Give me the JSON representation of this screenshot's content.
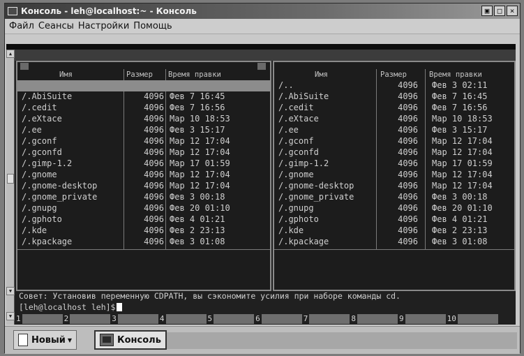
{
  "window": {
    "title": "Консоль - leh@localhost:~ - Консоль",
    "buttons": [
      "▣",
      "□",
      "×"
    ]
  },
  "menu": [
    "Файл",
    "Сеансы",
    "Настройки",
    "Помощь"
  ],
  "left_panel": {
    "headers": {
      "name": "Имя",
      "size": "Размер",
      "mtime": "Время правки"
    },
    "rows": [
      {
        "name": "",
        "size": "",
        "date": "",
        "selected": true
      },
      {
        "name": "/.AbiSuite",
        "size": "4096",
        "date": "Фев  7 16:45"
      },
      {
        "name": "/.cedit",
        "size": "4096",
        "date": "Фев  7 16:56"
      },
      {
        "name": "/.eXtace",
        "size": "4096",
        "date": "Мар 10 18:53"
      },
      {
        "name": "/.ee",
        "size": "4096",
        "date": "Фев  3 15:17"
      },
      {
        "name": "/.gconf",
        "size": "4096",
        "date": "Мар 12 17:04"
      },
      {
        "name": "/.gconfd",
        "size": "4096",
        "date": "Мар 12 17:04"
      },
      {
        "name": "/.gimp-1.2",
        "size": "4096",
        "date": "Мар 17 01:59"
      },
      {
        "name": "/.gnome",
        "size": "4096",
        "date": "Мар 12 17:04"
      },
      {
        "name": "/.gnome-desktop",
        "size": "4096",
        "date": "Мар 12 17:04"
      },
      {
        "name": "/.gnome_private",
        "size": "4096",
        "date": "Фев  3 00:18"
      },
      {
        "name": "/.gnupg",
        "size": "4096",
        "date": "Фев 20 01:10"
      },
      {
        "name": "/.gphoto",
        "size": "4096",
        "date": "Фев  4 01:21"
      },
      {
        "name": "/.kde",
        "size": "4096",
        "date": "Фев  2 23:13"
      },
      {
        "name": "/.kpackage",
        "size": "4096",
        "date": "Фев  3 01:08"
      }
    ]
  },
  "right_panel": {
    "headers": {
      "name": "Имя",
      "size": "Размер",
      "mtime": "Время правки"
    },
    "rows": [
      {
        "name": "/..",
        "size": "4096",
        "date": "Фев  3 02:11"
      },
      {
        "name": "/.AbiSuite",
        "size": "4096",
        "date": "Фев  7 16:45"
      },
      {
        "name": "/.cedit",
        "size": "4096",
        "date": "Фев  7 16:56"
      },
      {
        "name": "/.eXtace",
        "size": "4096",
        "date": "Мар 10 18:53"
      },
      {
        "name": "/.ee",
        "size": "4096",
        "date": "Фев  3 15:17"
      },
      {
        "name": "/.gconf",
        "size": "4096",
        "date": "Мар 12 17:04"
      },
      {
        "name": "/.gconfd",
        "size": "4096",
        "date": "Мар 12 17:04"
      },
      {
        "name": "/.gimp-1.2",
        "size": "4096",
        "date": "Мар 17 01:59"
      },
      {
        "name": "/.gnome",
        "size": "4096",
        "date": "Мар 12 17:04"
      },
      {
        "name": "/.gnome-desktop",
        "size": "4096",
        "date": "Мар 12 17:04"
      },
      {
        "name": "/.gnome_private",
        "size": "4096",
        "date": "Фев  3 00:18"
      },
      {
        "name": "/.gnupg",
        "size": "4096",
        "date": "Фев 20 01:10"
      },
      {
        "name": "/.gphoto",
        "size": "4096",
        "date": "Фев  4 01:21"
      },
      {
        "name": "/.kde",
        "size": "4096",
        "date": "Фев  2 23:13"
      },
      {
        "name": "/.kpackage",
        "size": "4096",
        "date": "Фев  3 01:08"
      }
    ]
  },
  "hint": "Совет: Установив переменную CDPATH, вы сэкономите усилия при наборе команды cd.",
  "prompt": "[leh@localhost leh]$",
  "fkeys": [
    "1",
    "2",
    "3",
    "4",
    "5",
    "6",
    "7",
    "8",
    "9",
    "10"
  ],
  "taskbar": {
    "new_tab": "Новый",
    "session_tab": "Консоль"
  }
}
